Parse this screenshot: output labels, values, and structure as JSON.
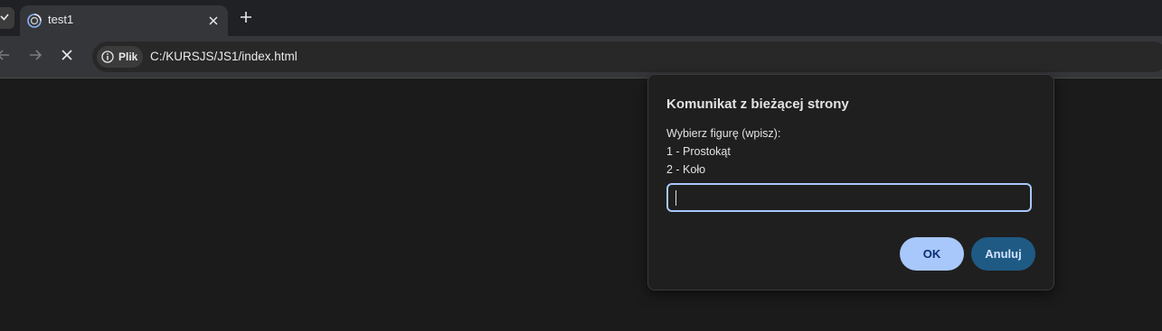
{
  "browser": {
    "tab": {
      "title": "test1"
    },
    "address_bar": {
      "security_chip_label": "Plik",
      "url": "C:/KURSJS/JS1/index.html"
    },
    "icons": {
      "back": "back-arrow-icon",
      "forward": "forward-arrow-icon",
      "stop": "stop-icon",
      "info": "info-icon"
    }
  },
  "dialog": {
    "title": "Komunikat z bieżącej strony",
    "message_lines": [
      "Wybierz figurę (wpisz):",
      "1 - Prostokąt",
      "2 - Koło"
    ],
    "input_value": "",
    "ok_label": "OK",
    "cancel_label": "Anuluj"
  },
  "colors": {
    "accent": "#a8c7fa",
    "cancel_button": "#1f5a85",
    "page_background": "#1b1b1b"
  }
}
